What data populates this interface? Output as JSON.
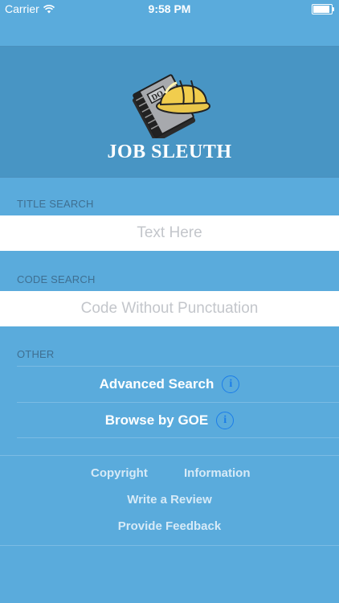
{
  "status_bar": {
    "carrier": "Carrier",
    "time": "9:58 PM"
  },
  "header": {
    "title": "JOB SLEUTH",
    "logo_icon": "job-book-hardhat-logo"
  },
  "title_search": {
    "label": "TITLE SEARCH",
    "placeholder": "Text Here",
    "value": ""
  },
  "code_search": {
    "label": "CODE SEARCH",
    "placeholder": "Code Without Punctuation",
    "value": ""
  },
  "other": {
    "label": "OTHER",
    "items": [
      {
        "label": "Advanced Search",
        "icon": "info-icon"
      },
      {
        "label": "Browse by GOE",
        "icon": "info-icon"
      }
    ]
  },
  "footer": {
    "copyright": "Copyright",
    "information": "Information",
    "review": "Write a Review",
    "feedback": "Provide Feedback"
  },
  "colors": {
    "background": "#5aabdc",
    "header": "#4895c4",
    "info_blue": "#1b7de8",
    "label": "#3f6f91"
  }
}
